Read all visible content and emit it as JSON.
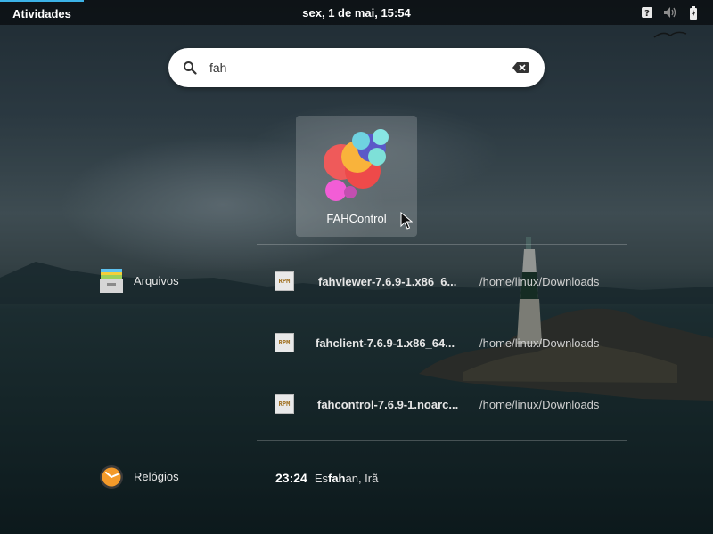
{
  "topbar": {
    "activities_label": "Atividades",
    "clock": "sex,  1 de mai, 15:54",
    "tray_icons": [
      "help-icon",
      "volume-icon",
      "battery-icon"
    ]
  },
  "search": {
    "value": "fah",
    "clear_icon": "clear-icon"
  },
  "app_result": {
    "label": "FAHControl",
    "icon": "fahcontrol-app-icon"
  },
  "providers": {
    "files_label": "Arquivos",
    "clocks_label": "Relógios"
  },
  "file_results": [
    {
      "name": "fahviewer-7.6.9-1.x86_6...",
      "path": "/home/linux/Downloads"
    },
    {
      "name": "fahclient-7.6.9-1.x86_64...",
      "path": "/home/linux/Downloads"
    },
    {
      "name": "fahcontrol-7.6.9-1.noarc...",
      "path": "/home/linux/Downloads"
    }
  ],
  "rpm_icon_text": "RPM",
  "clock_result": {
    "time": "23:24",
    "place_prefix": "Es",
    "place_match": "fah",
    "place_suffix": "an, Irã"
  },
  "colors": {
    "accent": "#3cb2e6"
  }
}
